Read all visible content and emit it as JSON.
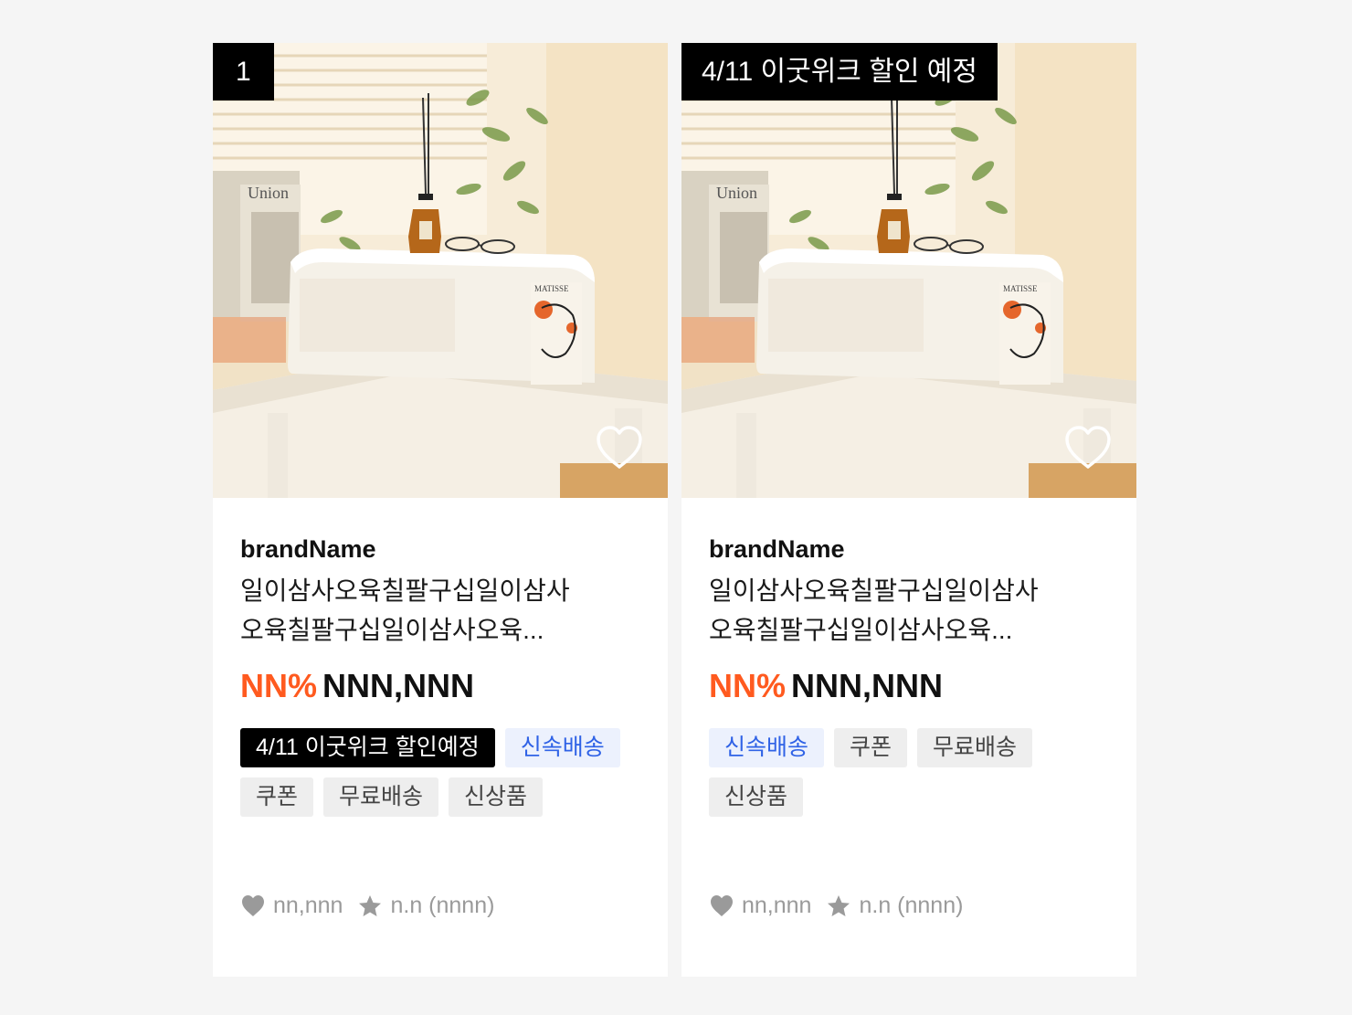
{
  "products": [
    {
      "corner_badge": "1",
      "brand": "brandName",
      "title": "일이삼사오육칠팔구십일이삼사오육칠팔구십일이삼사오육...",
      "discount": "NN%",
      "price": "NNN,NNN",
      "tags": [
        {
          "label": "4/11 이굿위크 할인예정",
          "style": "dark"
        },
        {
          "label": "신속배송",
          "style": "blue"
        },
        {
          "label": "쿠폰",
          "style": "gray"
        },
        {
          "label": "무료배송",
          "style": "gray"
        },
        {
          "label": "신상품",
          "style": "gray"
        }
      ],
      "likes": "nn,nnn",
      "rating": "n.n (nnnn)",
      "photo_text": {
        "book": "Union",
        "poster": "MATISSE"
      }
    },
    {
      "corner_badge": "4/11 이굿위크 할인 예정",
      "brand": "brandName",
      "title": "일이삼사오육칠팔구십일이삼사오육칠팔구십일이삼사오육...",
      "discount": "NN%",
      "price": "NNN,NNN",
      "tags": [
        {
          "label": "신속배송",
          "style": "blue"
        },
        {
          "label": "쿠폰",
          "style": "gray"
        },
        {
          "label": "무료배송",
          "style": "gray"
        },
        {
          "label": "신상품",
          "style": "gray"
        }
      ],
      "likes": "nn,nnn",
      "rating": "n.n (nnnn)",
      "photo_text": {
        "book": "Union",
        "poster": "MATISSE"
      }
    }
  ],
  "icons": {
    "wish": "heart-outline-icon",
    "likes": "heart-filled-icon",
    "rating": "star-icon"
  },
  "colors": {
    "discount": "#ff5a1f",
    "fast_delivery": "#2f62e6",
    "fast_delivery_bg": "#ecf1fd",
    "badge_bg": "#000000",
    "meta": "#9a9a9a"
  }
}
